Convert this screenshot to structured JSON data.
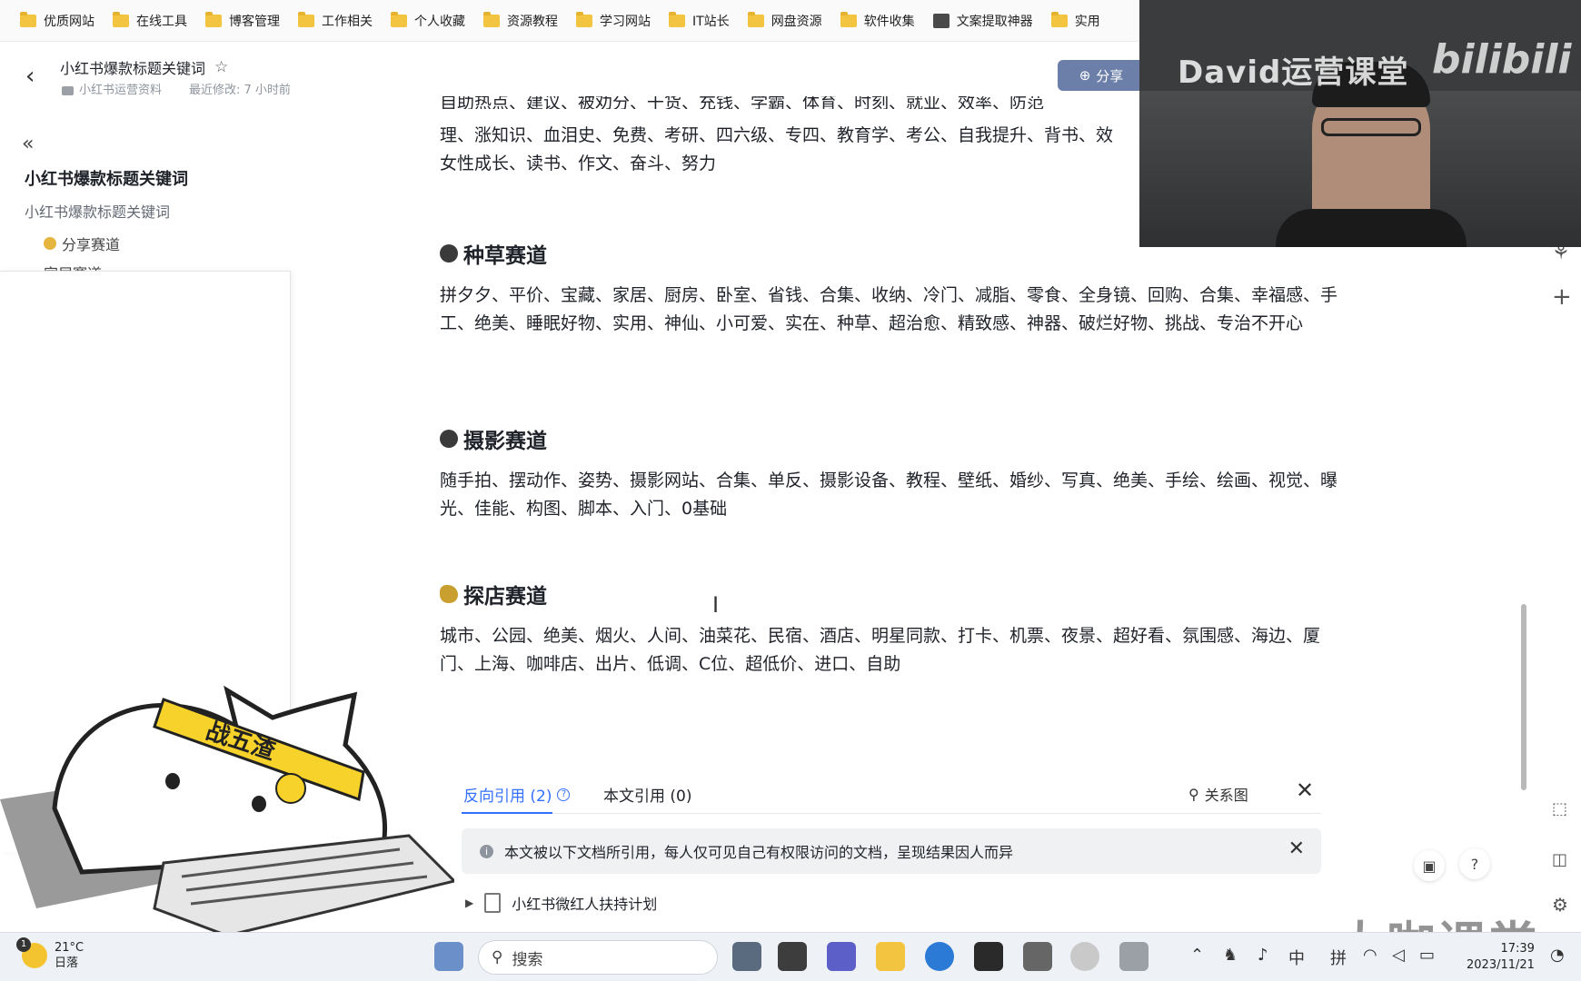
{
  "bookmarks": [
    {
      "label": "优质网站",
      "icon": "folder-icon"
    },
    {
      "label": "在线工具",
      "icon": "folder-icon"
    },
    {
      "label": "博客管理",
      "icon": "folder-icon"
    },
    {
      "label": "工作相关",
      "icon": "folder-icon"
    },
    {
      "label": "个人收藏",
      "icon": "folder-icon"
    },
    {
      "label": "资源教程",
      "icon": "folder-icon"
    },
    {
      "label": "学习网站",
      "icon": "folder-icon"
    },
    {
      "label": "IT站长",
      "icon": "folder-icon"
    },
    {
      "label": "网盘资源",
      "icon": "folder-icon"
    },
    {
      "label": "软件收集",
      "icon": "folder-icon"
    },
    {
      "label": "文案提取神器",
      "icon": "app-icon"
    },
    {
      "label": "实用",
      "icon": "folder-icon"
    }
  ],
  "header": {
    "title": "小红书爆款标题关键词",
    "folder": "小红书运营资料",
    "modified": "最近修改: 7 小时前",
    "share_label": "分享"
  },
  "sidebar": {
    "title": "小红书爆款标题关键词",
    "subtitle": "小红书爆款标题关键词",
    "item_share": "分享赛道",
    "item_partial": "家居赛道"
  },
  "content": {
    "top_partial": "自助热点、建议、被劝分、干货、充钱、学霸、体育、时刻、就业、效率、防范",
    "first_para": "理、涨知识、血泪史、免费、考研、四六级、专四、教育学、考公、自我提升、背书、效率、女性成长、读书、作文、奋斗、努力",
    "first_line1": "理、涨知识、血泪史、免费、考研、四六级、专四、教育学、考公、自我提升、背书、效",
    "first_line2": "女性成长、读书、作文、奋斗、努力",
    "sections": [
      {
        "title": "种草赛道",
        "text": "拼夕夕、平价、宝藏、家居、厨房、卧室、省钱、合集、收纳、冷门、减脂、零食、全身镜、回购、合集、幸福感、手工、绝美、睡眠好物、实用、神仙、小可爱、实在、种草、超治愈、精致感、神器、破烂好物、挑战、专治不开心"
      },
      {
        "title": "摄影赛道",
        "text": "随手拍、摆动作、姿势、摄影网站、合集、单反、摄影设备、教程、壁纸、婚纱、写真、绝美、手绘、绘画、视觉、曝光、佳能、构图、脚本、入门、0基础"
      },
      {
        "title": "探店赛道",
        "text": "城市、公园、绝美、烟火、人间、油菜花、民宿、酒店、明星同款、打卡、机票、夜景、超好看、氛围感、海边、厦门、上海、咖啡店、出片、低调、C位、超低价、进口、自助"
      }
    ]
  },
  "references": {
    "tab_backlinks": "反向引用 (2)",
    "tab_citations": "本文引用 (0)",
    "graph_label": "关系图",
    "notice": "本文被以下文档所引用，每人仅可见自己有权限访问的文档，呈现结果因人而异",
    "item": "小红书微红人扶持计划"
  },
  "video_overlay": {
    "title": "David运营课堂",
    "logo": "bilibili"
  },
  "sticker": {
    "headband": "战五渣"
  },
  "taskbar": {
    "temperature": "21°C",
    "weather_desc": "日落",
    "weather_badge": "1",
    "search_placeholder": "搜索",
    "ime_1": "中",
    "ime_2": "拼",
    "time": "17:39",
    "date": "2023/11/21"
  },
  "watermark": "大咖课堂",
  "colors": {
    "accent": "#3370ff",
    "folder": "#f3c440",
    "text": "#1f2329",
    "muted": "#8f959e"
  }
}
